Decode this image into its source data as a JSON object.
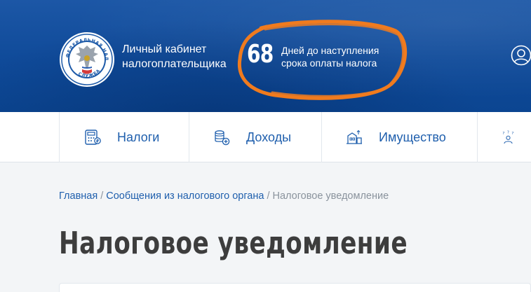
{
  "header": {
    "cabinet_title_line1": "Личный кабинет",
    "cabinet_title_line2": "налогоплательщика",
    "days_left": "68",
    "days_caption_line1": "Дней до наступления",
    "days_caption_line2": "срока оплаты налога",
    "logo_icon": "fns-emblem-icon",
    "profile_icon": "user-profile-icon",
    "highlight_color": "#f07b1e",
    "background_color": "#0f4a99"
  },
  "nav": {
    "items": [
      {
        "label": "Налоги",
        "icon": "calculator-icon"
      },
      {
        "label": "Доходы",
        "icon": "coins-icon"
      },
      {
        "label": "Имущество",
        "icon": "property-icon"
      },
      {
        "label": "",
        "icon": "people-question-icon"
      }
    ],
    "link_color": "#1f5fad"
  },
  "breadcrumb": {
    "home": "Главная",
    "messages": "Сообщения из налогового органа",
    "current": "Налоговое уведомление",
    "separator": "/"
  },
  "page": {
    "title": "Налоговое уведомление"
  }
}
